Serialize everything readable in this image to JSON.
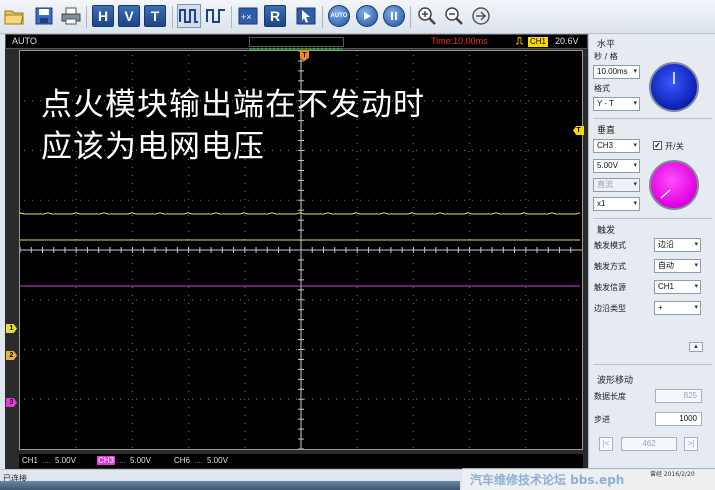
{
  "toolbar": {
    "letters": [
      "H",
      "V",
      "T",
      "R"
    ],
    "auto_label": "AUTO"
  },
  "scope": {
    "mode": "AUTO",
    "time_info": "Time:10.00ms",
    "trigger_source": "CH1",
    "trigger_level": "20.6V",
    "overlay_line1": "点火模块输出端在不发动时",
    "overlay_line2": "应该为电网电压",
    "marker_ch1": "1",
    "marker_ch2": "2",
    "marker_ch3": "3",
    "marker_trig": "T",
    "marker_time": "T",
    "status": {
      "ch1_name": "CH1",
      "ch1_dots": "....",
      "ch1_value": "5.00V",
      "ch3_name": "CH3",
      "ch3_dots": "....",
      "ch3_value": "5.00V",
      "ch6_name": "CH6",
      "ch6_dots": "....",
      "ch6_value": "5.00V"
    },
    "colors": {
      "trace_yellow": "#e8d96a",
      "trace_magenta": "#e03ae0",
      "grid_dot": "#7a7a7a"
    }
  },
  "side_panel": {
    "horizontal": {
      "title": "水平",
      "timebase_label": "秒 / 格",
      "timebase_value": "10.00ms",
      "format_label": "格式",
      "format_value": "Y - T"
    },
    "vertical": {
      "title": "垂直",
      "channel_value": "CH3",
      "onoff_label": "开/关",
      "volts_value": "5.00V",
      "coupling_value": "直流",
      "probe_value": "x1"
    },
    "trigger": {
      "title": "触发",
      "mode_label": "触发模式",
      "mode_value": "边沿",
      "method_label": "触发方式",
      "method_value": "自动",
      "source_label": "触发信源",
      "source_value": "CH1",
      "edge_label": "边沿类型",
      "edge_value": "+"
    },
    "waveform": {
      "title": "波形移动",
      "length_label": "数据长度",
      "length_value": "825",
      "step_label": "步进",
      "step_value": "1000",
      "prev_label": "|<",
      "position_value": "462",
      "next_label": ">|"
    }
  },
  "statusbar": {
    "text": "已连接"
  },
  "watermark": {
    "text": "汽车维修技术论坛 bbs.eph",
    "small": "曾经 2016/2/20"
  }
}
